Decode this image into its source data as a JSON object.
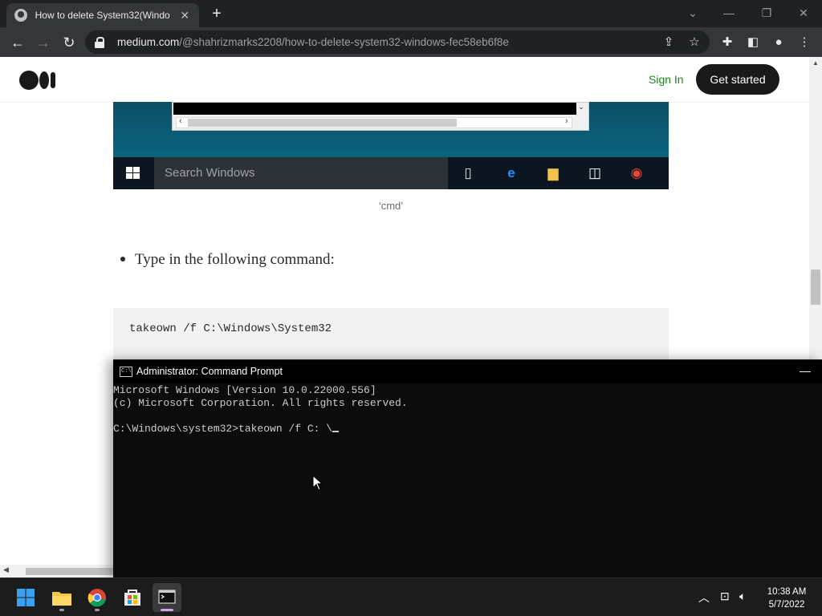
{
  "browser": {
    "tab_title": "How to delete System32(Windo",
    "url_host": "medium.com",
    "url_path": "/@shahrizmarks2208/how-to-delete-system32-windows-fec58eb6f8e"
  },
  "site": {
    "sign_in": "Sign In",
    "get_started": "Get started",
    "accent_color": "#1a8917"
  },
  "article": {
    "image": {
      "search_placeholder": "Search Windows"
    },
    "caption": "‘cmd’",
    "bullet_text": "Type in the following command:",
    "code": "takeown /f C:\\Windows\\System32"
  },
  "cmd_window": {
    "title": "Administrator: Command Prompt",
    "lines": [
      "Microsoft Windows [Version 10.0.22000.556]",
      "(c) Microsoft Corporation. All rights reserved.",
      "",
      "C:\\Windows\\system32>takeown /f C: \\"
    ]
  },
  "taskbar": {
    "time": "10:38 AM",
    "date": "5/7/2022"
  }
}
